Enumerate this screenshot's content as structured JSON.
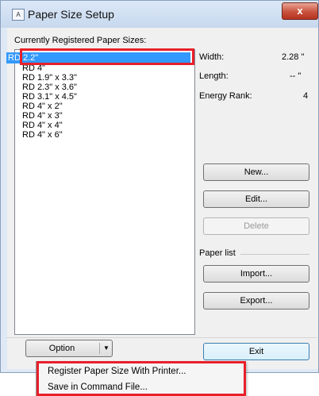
{
  "window": {
    "title": "Paper Size Setup",
    "close_glyph": "x",
    "app_icon_text": "A"
  },
  "list": {
    "heading": "Currently Registered Paper Sizes:",
    "items": [
      "RD 2.2\"",
      "RD 4\"",
      "RD 1.9\" x 3.3\"",
      "RD 2.3\" x 3.6\"",
      "RD 3.1\" x 4.5\"",
      "RD 4\" x 2\"",
      "RD 4\" x 3\"",
      "RD 4\" x 4\"",
      "RD 4\" x 6\""
    ],
    "selected_index": 0
  },
  "info": {
    "width_label": "Width:",
    "width_value": "2.28 \"",
    "length_label": "Length:",
    "length_value": "-- \"",
    "energy_label": "Energy Rank:",
    "energy_value": "4"
  },
  "buttons": {
    "new": "New...",
    "edit": "Edit...",
    "delete": "Delete",
    "paper_list": "Paper list",
    "import": "Import...",
    "export": "Export...",
    "option": "Option",
    "exit": "Exit"
  },
  "menu": {
    "items": [
      "Register Paper Size With Printer...",
      "Save in Command File..."
    ]
  },
  "colors": {
    "highlight": "#e8202a",
    "selection": "#3399ff"
  }
}
